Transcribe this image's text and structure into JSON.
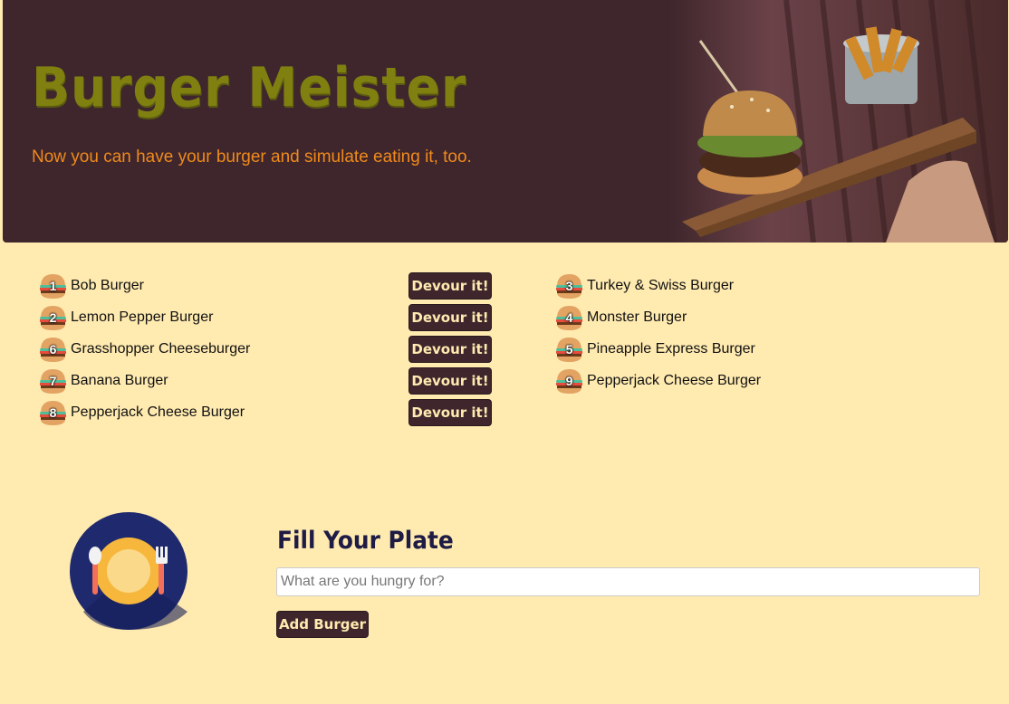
{
  "header": {
    "title": "Burger Meister",
    "subtitle": "Now you can have your burger and simulate eating it, too."
  },
  "uneaten": [
    {
      "id": "1",
      "name": "Bob Burger",
      "button": "Devour it!"
    },
    {
      "id": "2",
      "name": "Lemon Pepper Burger",
      "button": "Devour it!"
    },
    {
      "id": "6",
      "name": "Grasshopper Cheeseburger",
      "button": "Devour it!"
    },
    {
      "id": "7",
      "name": "Banana Burger",
      "button": "Devour it!"
    },
    {
      "id": "8",
      "name": "Pepperjack Cheese Burger",
      "button": "Devour it!"
    }
  ],
  "devoured": [
    {
      "id": "3",
      "name": "Turkey & Swiss Burger"
    },
    {
      "id": "4",
      "name": "Monster Burger"
    },
    {
      "id": "5",
      "name": "Pineapple Express Burger"
    },
    {
      "id": "9",
      "name": "Pepperjack Cheese Burger"
    }
  ],
  "form": {
    "title": "Fill Your Plate",
    "placeholder": "What are you hungry for?",
    "value": "",
    "submit_label": "Add Burger"
  },
  "colors": {
    "background": "#ffeab0",
    "header": "#3e262c",
    "title": "#7f8010",
    "subtitle": "#f08a1c",
    "button_bg": "#3e262c",
    "button_text": "#ffeab0",
    "form_title": "#1e1b45"
  },
  "icons": {
    "burger": "burger-icon",
    "plate": "plate-fork-spoon-icon",
    "hero": "burger-fries-photo"
  }
}
